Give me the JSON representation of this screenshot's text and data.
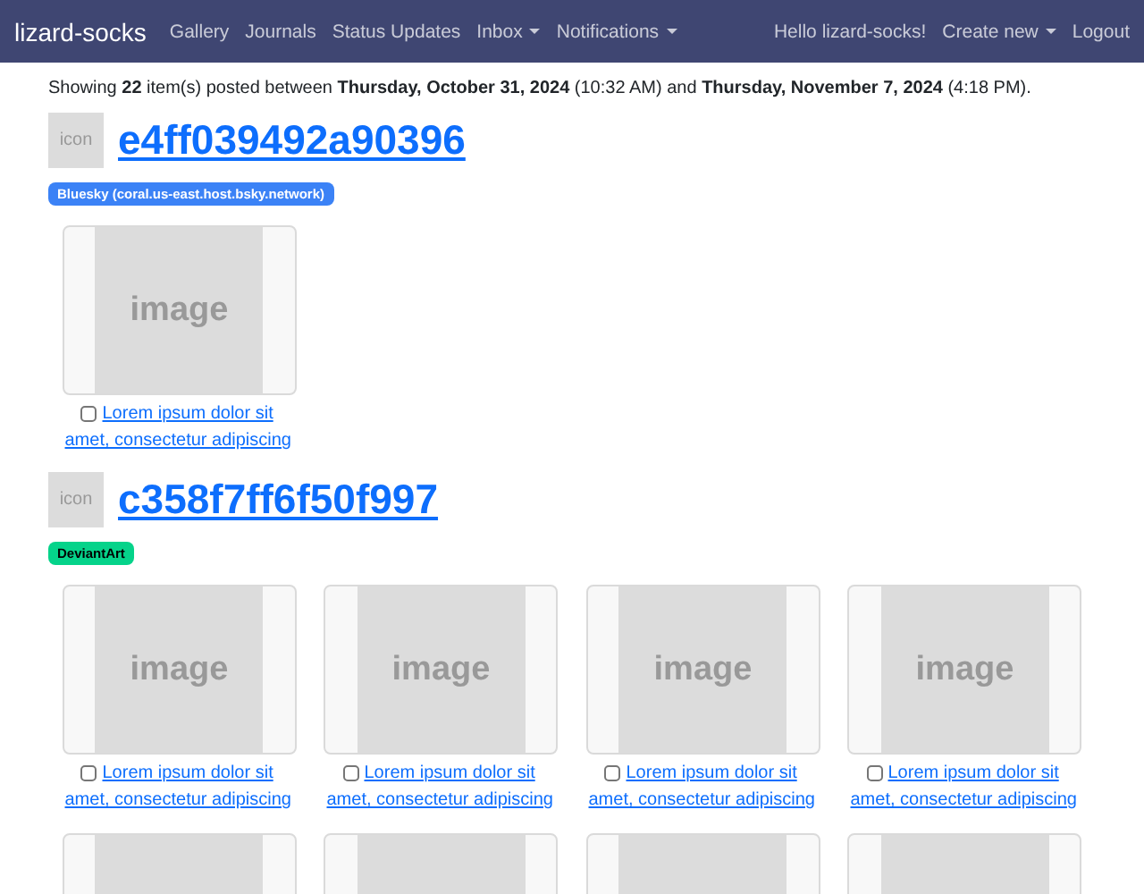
{
  "navbar": {
    "brand": "lizard-socks",
    "links": [
      {
        "label": "Gallery",
        "dropdown": false
      },
      {
        "label": "Journals",
        "dropdown": false
      },
      {
        "label": "Status Updates",
        "dropdown": false
      },
      {
        "label": "Inbox",
        "dropdown": true
      },
      {
        "label": "Notifications",
        "dropdown": true
      }
    ],
    "right": [
      {
        "label": "Hello lizard-socks!",
        "dropdown": false
      },
      {
        "label": "Create new",
        "dropdown": true
      },
      {
        "label": "Logout",
        "dropdown": false
      }
    ]
  },
  "summary": "Showing **22** item(s) posted between **Thursday, October 31, 2024** (10:32 AM) and **Thursday, November 7, 2024** (4:18 PM).",
  "groups": [
    {
      "icon": "icon",
      "title": "e4ff039492a90396",
      "badge": "Bluesky (coral.us-east.host.bsky.network)",
      "color": "#3b82f6",
      "items": [
        {
          "kind": "full",
          "image": "image",
          "caption": "Lorem ipsum dolor sit amet, consectetur adipiscing",
          "checked": false
        }
      ]
    },
    {
      "icon": "icon",
      "title": "c358f7ff6f50f997",
      "badge": "DeviantArt",
      "color": "#05d38a",
      "items": [
        {
          "kind": "full",
          "image": "image",
          "caption": "Lorem ipsum dolor sit amet, consectetur adipiscing",
          "checked": false
        },
        {
          "kind": "full",
          "image": "image",
          "caption": "Lorem ipsum dolor sit amet, consectetur adipiscing",
          "checked": false
        },
        {
          "kind": "full",
          "image": "image",
          "caption": "Lorem ipsum dolor sit amet, consectetur adipiscing",
          "checked": false
        },
        {
          "kind": "full",
          "image": "image",
          "caption": "Lorem ipsum dolor sit amet, consectetur adipiscing",
          "checked": false
        },
        {
          "kind": "cut"
        },
        {
          "kind": "cut"
        },
        {
          "kind": "cut"
        },
        {
          "kind": "cut"
        }
      ]
    }
  ]
}
